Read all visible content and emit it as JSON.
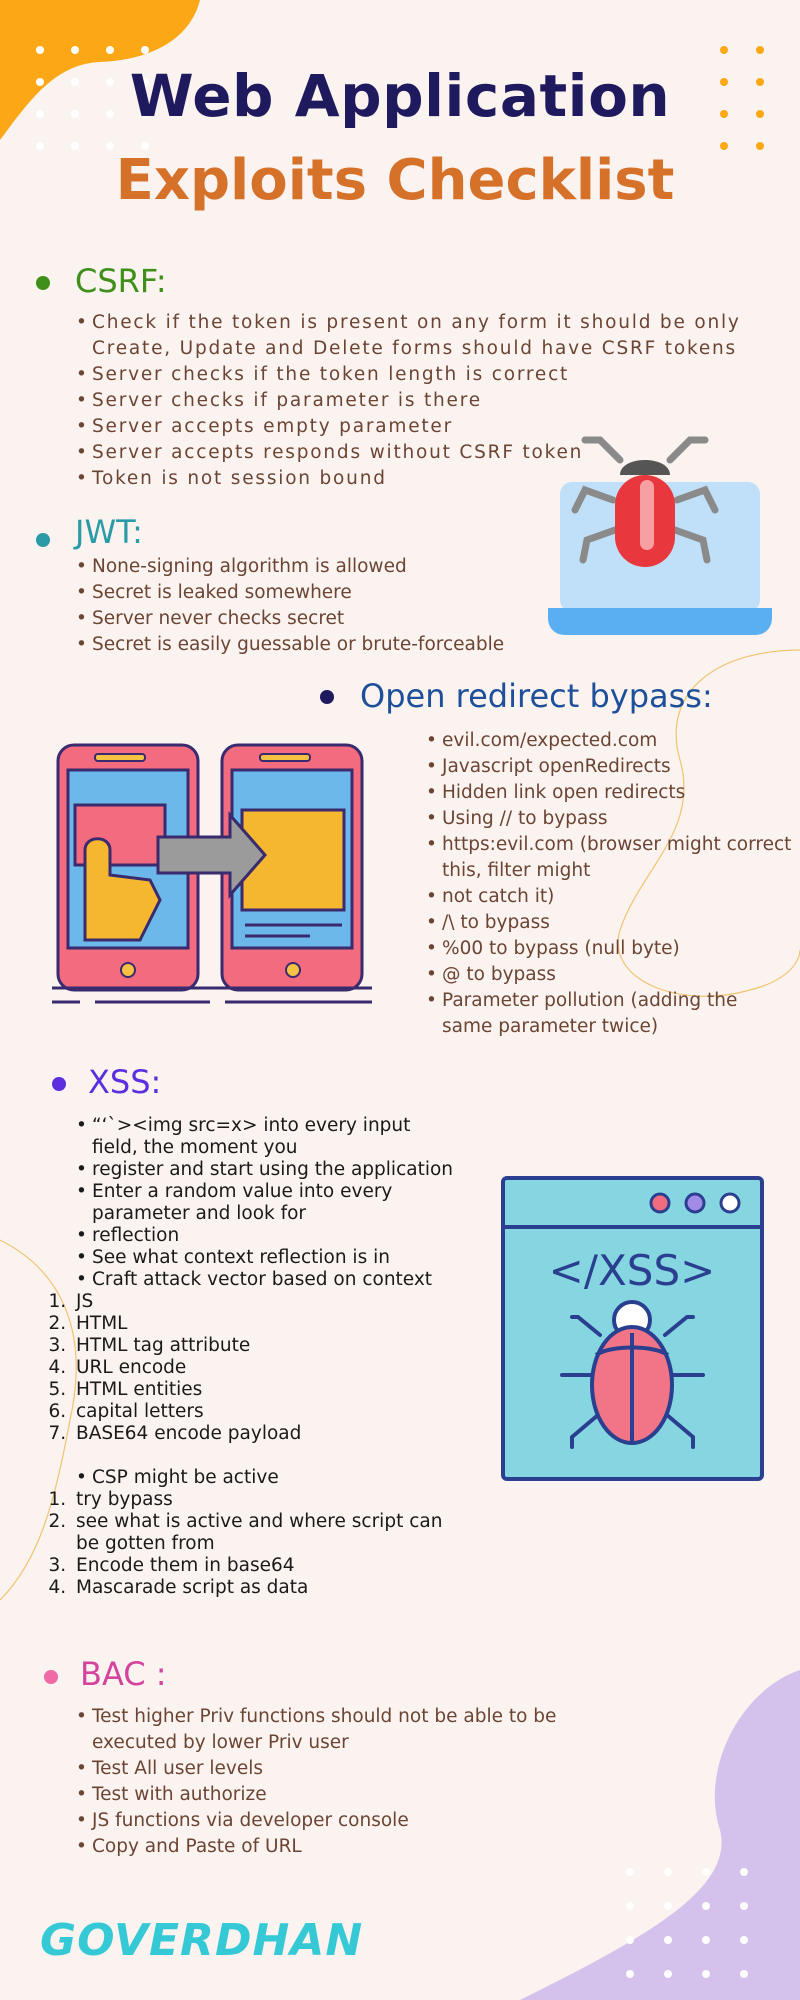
{
  "title": {
    "line1": "Web Application",
    "line2": "Exploits Checklist"
  },
  "colors": {
    "bg": "#faf3ef",
    "navy": "#1f1a5e",
    "orange": "#d6712a",
    "green": "#3f8f1a",
    "teal": "#2a9aa6",
    "blue": "#1d4f9a",
    "purple": "#5b2ee0",
    "pink": "#d4449c",
    "brown": "#6b4434"
  },
  "csrf": {
    "heading": "CSRF:",
    "items": [
      "Check if the token is present on any form it should be only Create, Update and Delete forms should have CSRF tokens",
      "Server checks if the token length is correct",
      "Server checks if parameter is there",
      "Server accepts empty parameter",
      "Server accepts responds without CSRF token",
      "Token is not session bound"
    ]
  },
  "jwt": {
    "heading": "JWT:",
    "items": [
      "None-signing algorithm is allowed",
      "Secret is leaked somewhere",
      "Server never checks secret",
      "Secret is easily guessable or brute-forceable"
    ]
  },
  "redirect": {
    "heading": "Open redirect bypass:",
    "items": [
      "evil.com/expected.com",
      "Javascript openRedirects",
      "Hidden link open redirects",
      "Using // to bypass",
      "https:evil.com (browser might correct this, filter might",
      "not catch it)",
      "/\\ to bypass",
      "%00 to bypass (null byte)",
      "@ to bypass",
      "Parameter pollution (adding the same parameter twice)"
    ]
  },
  "xss": {
    "heading": "XSS:",
    "items": [
      "“‘`><img src=x> into every input field, the moment you",
      "register and start using the application",
      "Enter a random value into every parameter and look for",
      "reflection",
      "See what context reflection is in",
      "Craft attack vector based on context"
    ],
    "contexts": [
      "JS",
      "HTML",
      "HTML tag attribute",
      "URL encode",
      "HTML entities",
      "capital letters",
      "BASE64 encode payload"
    ],
    "csp_item": "CSP might be active",
    "csp_steps": [
      "try bypass",
      "see what is active and where script can be gotten from",
      "Encode them in base64",
      "Mascarade script as data"
    ],
    "illustration_text": "</XSS>"
  },
  "bac": {
    "heading": "BAC :",
    "items": [
      "Test higher Priv functions should not be able to be executed by lower Priv user",
      "Test All user levels",
      "Test with authorize",
      "JS functions via developer console",
      "Copy and Paste of URL"
    ]
  },
  "signature": "GOVERDHAN"
}
